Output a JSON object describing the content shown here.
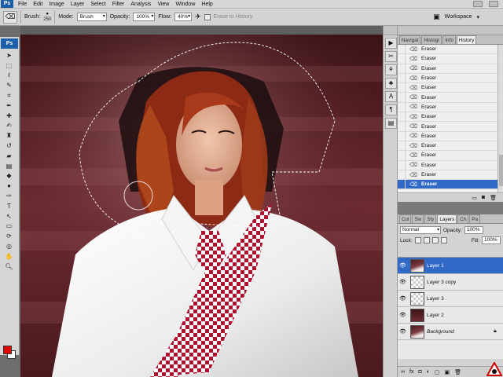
{
  "app": {
    "logo": "Ps"
  },
  "menu": [
    "File",
    "Edit",
    "Image",
    "Layer",
    "Select",
    "Filter",
    "Analysis",
    "View",
    "Window",
    "Help"
  ],
  "options": {
    "brush_label": "Brush:",
    "brush_size": "250",
    "mode_label": "Mode:",
    "mode_value": "Brush",
    "opacity_label": "Opacity:",
    "opacity_value": "100%",
    "flow_label": "Flow:",
    "flow_value": "40%",
    "erase_history_label": "Erase to History",
    "workspace_label": "Workspace"
  },
  "history_panel": {
    "tabs": [
      "Navigat",
      "Histogr",
      "Info",
      "History"
    ],
    "active_tab": "History",
    "items": [
      "Eraser",
      "Eraser",
      "Eraser",
      "Eraser",
      "Eraser",
      "Eraser",
      "Eraser",
      "Eraser",
      "Eraser",
      "Eraser",
      "Eraser",
      "Eraser",
      "Eraser",
      "Eraser",
      "Eraser"
    ],
    "selected_item": "Eraser"
  },
  "layers_panel": {
    "tabs": [
      "Col",
      "Sw",
      "Sty",
      "Layers",
      "Ch",
      "Pa"
    ],
    "active_tab": "Layers",
    "blend_mode": "Normal",
    "opacity_label": "Opacity:",
    "opacity_value": "100%",
    "lock_label": "Lock:",
    "fill_label": "Fill:",
    "fill_value": "100%",
    "layers": [
      {
        "name": "Layer 1",
        "selected": true
      },
      {
        "name": "Layer 3 copy",
        "selected": false
      },
      {
        "name": "Layer 3",
        "selected": false
      },
      {
        "name": "Layer 2",
        "selected": false
      },
      {
        "name": "Background",
        "selected": false
      }
    ]
  },
  "colors": {
    "foreground": "#e00000",
    "background": "#ffffff",
    "selection_blue": "#3169c6"
  }
}
